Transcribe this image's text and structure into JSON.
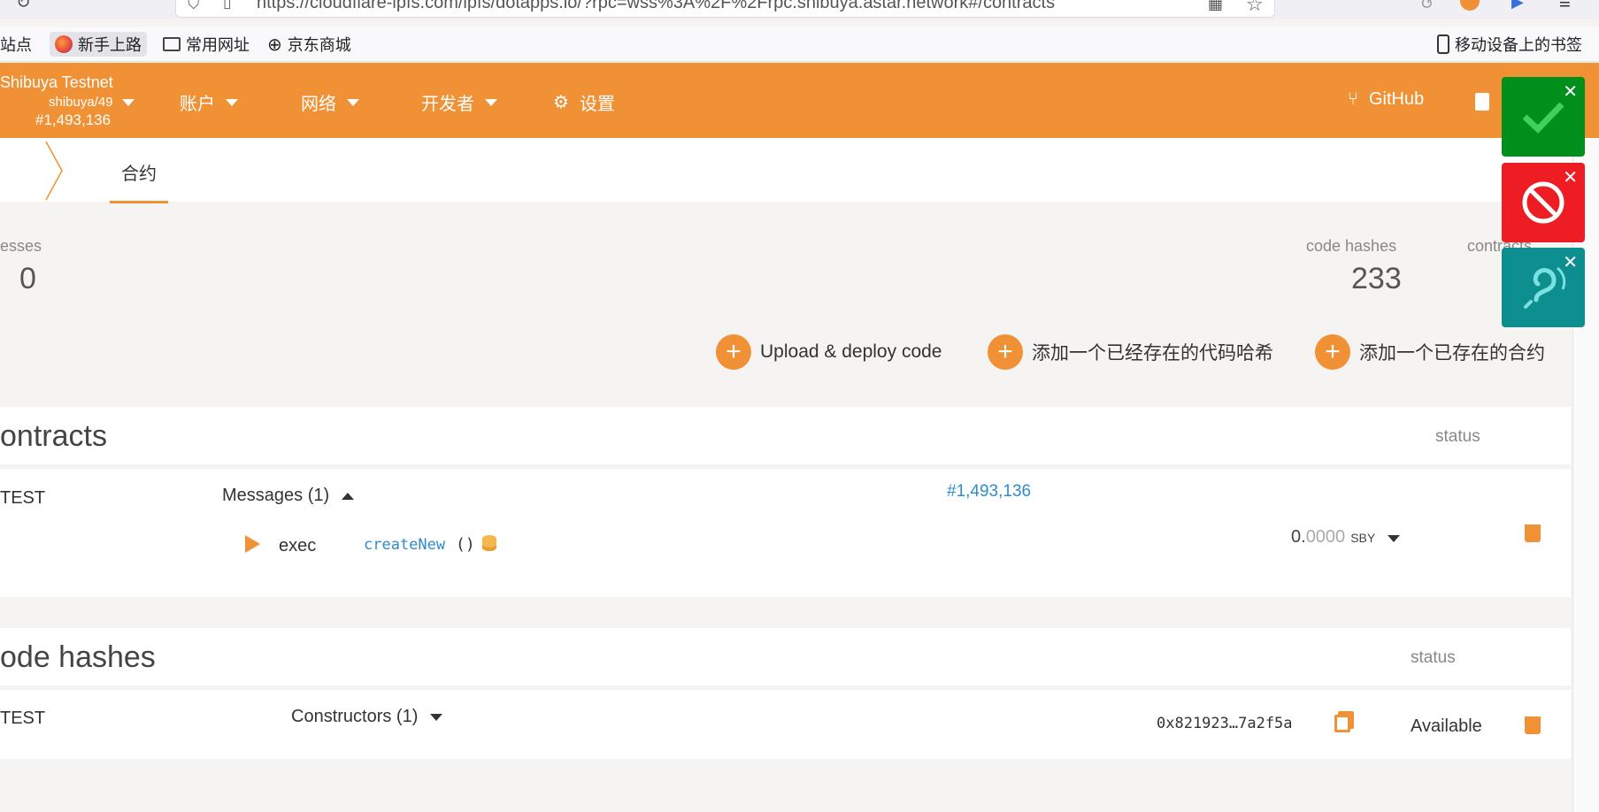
{
  "browser": {
    "url": "https://cloudflare-ipfs.com/ipfs/dotapps.io/?rpc=wss%3A%2F%2Frpc.shibuya.astar.network#/contracts",
    "bookmarks": [
      "站点",
      "新手上路",
      "常用网址",
      "京东商城"
    ],
    "mobile_bookmarks": "移动设备上的书签"
  },
  "header": {
    "chain_name": "Shibuya Testnet",
    "chain_version": "shibuya/49",
    "block_number": "#1,493,136",
    "menu": [
      "账户",
      "网络",
      "开发者",
      "设置"
    ],
    "github": "GitHub"
  },
  "tabs": {
    "active": "合约"
  },
  "summary": {
    "left_label": "esses",
    "left_value": "0",
    "code_hashes_label": "code hashes",
    "code_hashes_value": "233",
    "contracts_label": "contracts"
  },
  "actions": {
    "upload": "Upload & deploy code",
    "add_hash": "添加一个已经存在的代码哈希",
    "add_contract": "添加一个已存在的合约"
  },
  "contracts": {
    "title": "ontracts",
    "status_header": "status",
    "row": {
      "name": "TEST",
      "messages": "Messages (1)",
      "block": "#1,493,136",
      "message_type": "exec",
      "message_name": "createNew",
      "message_args": "()",
      "balance_int": "0.",
      "balance_dec": "0000",
      "balance_unit": "SBY"
    }
  },
  "code_hashes": {
    "title": "ode hashes",
    "status_header": "status",
    "row": {
      "name": "TEST",
      "constructors": "Constructors (1)",
      "hash": "0x821923…7a2f5a",
      "status": "Available"
    }
  },
  "colors": {
    "accent": "#f19135",
    "link": "#2f8bcc",
    "approve": "#008f1a",
    "block": "#ee1c23",
    "listen": "#0e8f8f"
  }
}
